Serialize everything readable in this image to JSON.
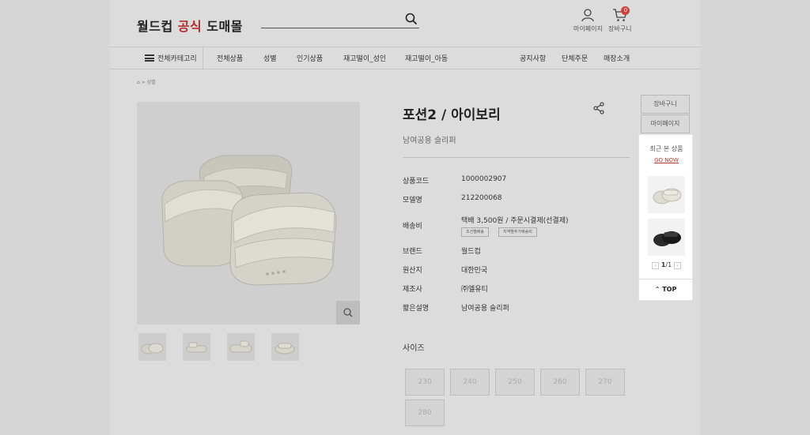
{
  "header": {
    "logo_part1": "월드컵 ",
    "logo_part2": "공식",
    "logo_part3": " 도매몰",
    "mypage_label": "마이페이지",
    "cart_label": "장바구니",
    "cart_count": "0",
    "brand_color": "#b03030"
  },
  "nav": {
    "all_category": "전체카테고리",
    "items": [
      "전체상품",
      "성별",
      "인기상품",
      "재고떨이_성인",
      "재고떨이_아동"
    ],
    "right_items": [
      "공지사항",
      "단체주문",
      "매장소개"
    ]
  },
  "breadcrumb": {
    "home_icon": "home-icon",
    "current": "성별"
  },
  "product": {
    "title": "포션2 / 아이보리",
    "subtitle": "남여공용 슬리퍼",
    "info": [
      {
        "label": "상품코드",
        "value": "1000002907"
      },
      {
        "label": "모델명",
        "value": "212200068"
      },
      {
        "label": "배송비",
        "value": "택배 3,500원  / 주문시결제(선결제)"
      },
      {
        "label": "브랜드",
        "value": "월드컵"
      },
      {
        "label": "원산지",
        "value": "대한민국"
      },
      {
        "label": "제조사",
        "value": "㈜엘유티"
      },
      {
        "label": "짧은설명",
        "value": "남여공용 슬리퍼"
      }
    ],
    "shipping_tags": [
      "조건별배송",
      "지역별추가배송비"
    ],
    "size_title": "사이즈",
    "sizes": [
      "230",
      "240",
      "250",
      "260",
      "270",
      "280"
    ]
  },
  "quick": {
    "cart": "장바구니",
    "mypage": "마이페이지",
    "recent_title": "최근 본 상품",
    "go_now": "GO NOW",
    "page_current": "1",
    "page_total": "/1",
    "top": "TOP"
  }
}
